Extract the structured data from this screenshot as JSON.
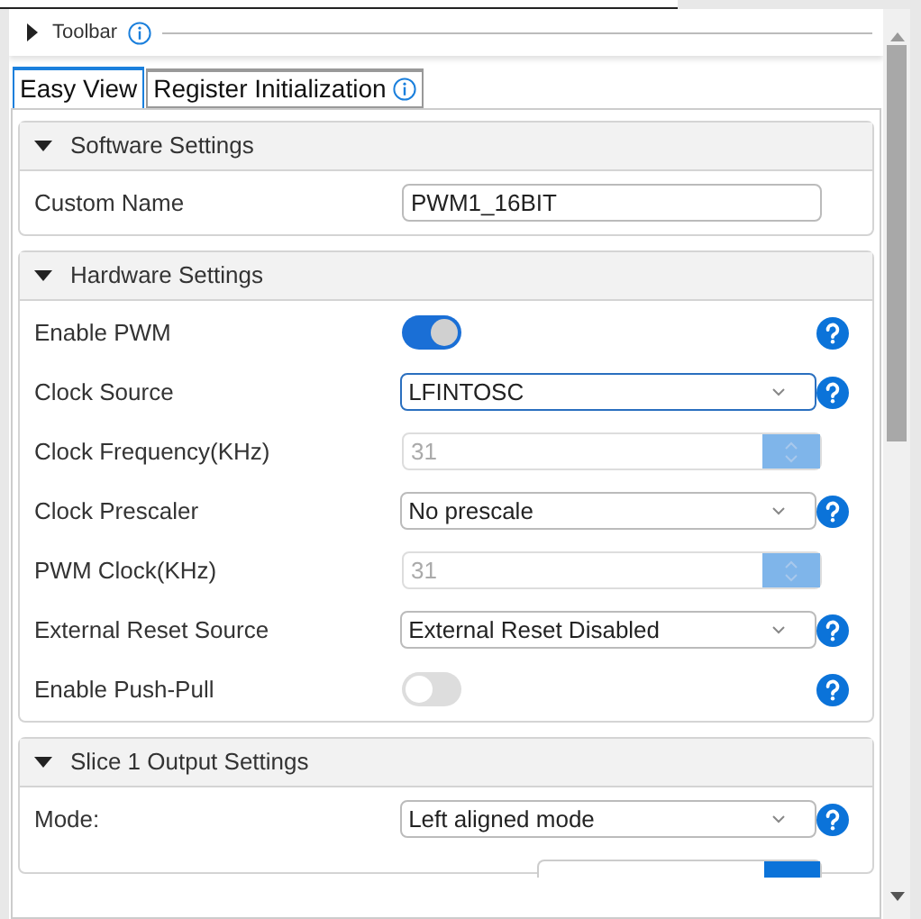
{
  "toolbar": {
    "label": "Toolbar",
    "expanded": false
  },
  "tabs": [
    {
      "label": "Easy View",
      "selected": true,
      "info": false
    },
    {
      "label": "Register Initialization",
      "selected": false,
      "info": true
    }
  ],
  "sections": [
    {
      "title": "Software Settings",
      "expanded": true,
      "rows": [
        {
          "kind": "text",
          "label": "Custom Name",
          "value": "PWM1_16BIT",
          "help": false
        }
      ]
    },
    {
      "title": "Hardware Settings",
      "expanded": true,
      "rows": [
        {
          "kind": "toggle",
          "label": "Enable PWM",
          "on": true,
          "help": true
        },
        {
          "kind": "select",
          "label": "Clock Source",
          "value": "LFINTOSC",
          "focused": true,
          "help": true
        },
        {
          "kind": "spinner",
          "label": "Clock Frequency(KHz)",
          "value": "31",
          "disabled": true,
          "help": false
        },
        {
          "kind": "select",
          "label": "Clock Prescaler",
          "value": "No prescale",
          "focused": false,
          "help": true
        },
        {
          "kind": "spinner",
          "label": "PWM Clock(KHz)",
          "value": "31",
          "disabled": true,
          "help": false
        },
        {
          "kind": "select",
          "label": "External Reset Source",
          "value": "External Reset Disabled",
          "focused": false,
          "help": true
        },
        {
          "kind": "toggle",
          "label": "Enable Push-Pull",
          "on": false,
          "help": true
        }
      ]
    },
    {
      "title": "Slice 1 Output Settings",
      "expanded": true,
      "rows": [
        {
          "kind": "select",
          "label": "Mode:",
          "value": "Left aligned mode",
          "focused": false,
          "help": true
        },
        {
          "kind": "partial-spinner"
        }
      ]
    }
  ]
}
